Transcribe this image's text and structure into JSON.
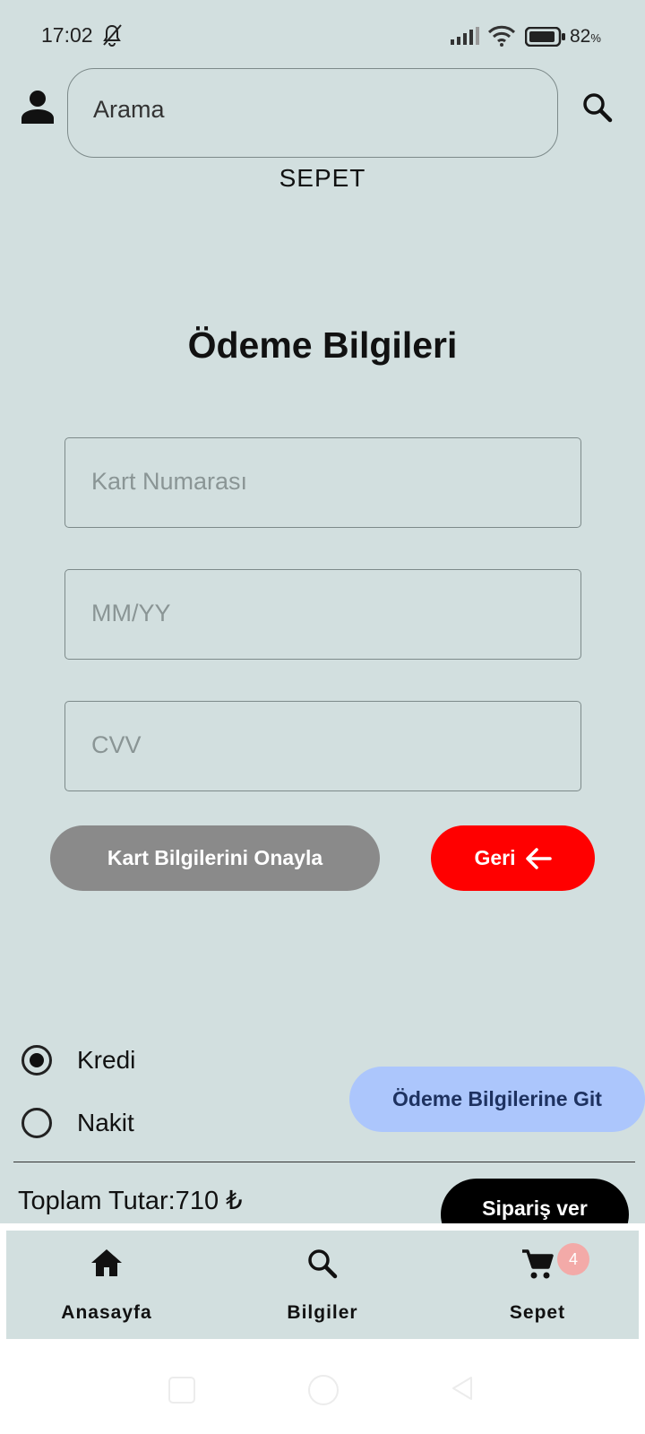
{
  "status_bar": {
    "time": "17:02",
    "battery_percent": "82",
    "battery_unit": "%"
  },
  "header": {
    "search_placeholder": "Arama",
    "page_label": "SEPET"
  },
  "payment_form": {
    "title": "Ödeme Bilgileri",
    "card_number_placeholder": "Kart Numarası",
    "expiry_placeholder": "MM/YY",
    "cvv_placeholder": "CVV",
    "confirm_label": "Kart Bilgilerini Onayla",
    "back_label": "Geri"
  },
  "payment_method": {
    "options": [
      {
        "label": "Kredi",
        "selected": true
      },
      {
        "label": "Nakit",
        "selected": false
      }
    ],
    "goto_label": "Ödeme Bilgilerine Git"
  },
  "footer": {
    "total_label": "Toplam Tutar:710 ₺",
    "order_label": "Sipariş ver"
  },
  "bottom_nav": {
    "items": [
      {
        "label": "Anasayfa",
        "icon": "home-icon"
      },
      {
        "label": "Bilgiler",
        "icon": "search-icon"
      },
      {
        "label": "Sepet",
        "icon": "cart-icon",
        "badge": "4"
      }
    ]
  },
  "colors": {
    "background": "#d2dfdf",
    "back_button": "#ff0000",
    "goto_button": "#acc6fc",
    "confirm_button": "#8a8a8a",
    "badge": "#f3aaa8"
  }
}
